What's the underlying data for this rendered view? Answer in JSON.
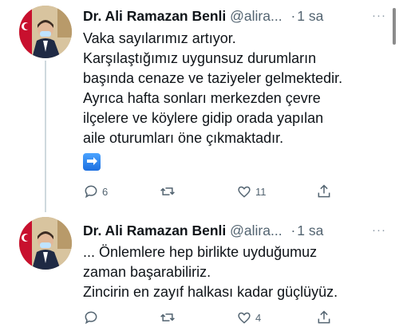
{
  "tweets": [
    {
      "name": "Dr. Ali Ramazan Benli",
      "handle": "@alira...",
      "dot": "·",
      "time": "1 sa",
      "more": "···",
      "lines": [
        "Vaka sayılarımız artıyor.",
        "Karşılaştığımız uygunsuz durumların",
        "başında cenaze ve taziyeler gelmektedir.",
        "Ayrıca hafta sonları merkezden çevre",
        "ilçelere ve köylere gidip orada yapılan",
        "aile oturumları öne çıkmaktadır."
      ],
      "reply_count": "6",
      "retweet_count": "",
      "like_count": "11"
    },
    {
      "name": "Dr. Ali Ramazan Benli",
      "handle": "@alira...",
      "dot": "·",
      "time": "1 sa",
      "more": "···",
      "lines": [
        "... Önlemlere hep birlikte uyduğumuz",
        "zaman başarabiliriz.",
        "Zincirin en zayıf halkası kadar güçlüyüz."
      ],
      "reply_count": "",
      "retweet_count": "",
      "like_count": "4"
    }
  ],
  "colors": {
    "text": "#0f1419",
    "secondary": "#536471",
    "thread_line": "#cfd9de"
  },
  "icons": [
    "reply-icon",
    "retweet-icon",
    "like-icon",
    "share-icon",
    "more-icon",
    "arrow-emoji-icon"
  ]
}
